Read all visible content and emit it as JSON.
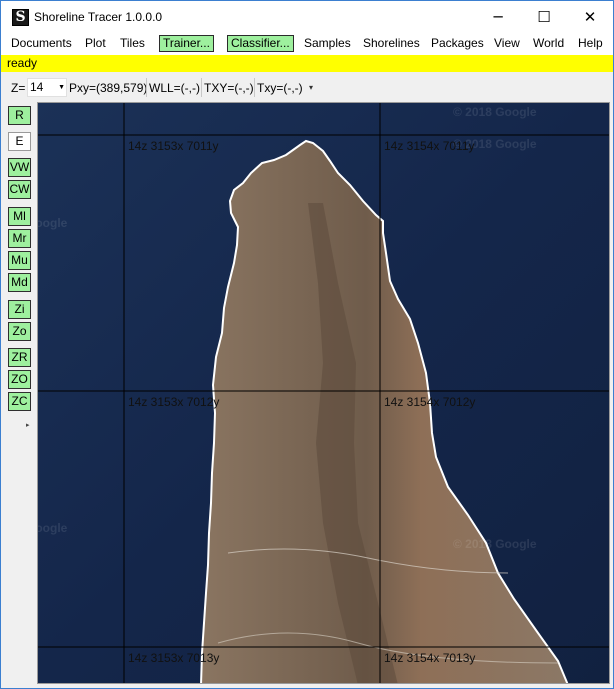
{
  "window": {
    "title": "Shoreline Tracer 1.0.0.0",
    "app_icon_letter": "S",
    "minimize_glyph": "─",
    "maximize_glyph": "☐",
    "close_glyph": "✕"
  },
  "menu": {
    "documents": "Documents",
    "plot": "Plot",
    "tiles": "Tiles",
    "trainer": "Trainer...",
    "classifier": "Classifier...",
    "samples": "Samples",
    "shorelines": "Shorelines",
    "packages": "Packages",
    "view": "View",
    "world": "World",
    "help": "Help"
  },
  "status": {
    "text": "ready"
  },
  "toolbar": {
    "zoom_label": "Z=",
    "zoom_value": "14",
    "pxy": "Pxy=(389,579)",
    "wll": "WLL=(-,-)",
    "txy": "TXY=(-,-)",
    "txy_lower": "Txy=(-,-)"
  },
  "tools": {
    "r": "R",
    "e": "E",
    "vw": "VW",
    "cw": "CW",
    "ml": "Ml",
    "mr": "Mr",
    "mu": "Mu",
    "md": "Md",
    "zi": "Zi",
    "zo": "Zo",
    "zr": "ZR",
    "zo_caps": "ZO",
    "zc": "ZC"
  },
  "map": {
    "tiles": [
      "14z 3153x 7011y",
      "14z 3154x 7011y",
      "14z 3153x 7012y",
      "14z 3154x 7012y",
      "14z 3153x 7013y",
      "14z 3154x 7013y"
    ],
    "watermarks": {
      "copyright_1": "© 2018 Google",
      "copyright_2": "© 2018 Google",
      "google_1": "Google",
      "google_2": "Google",
      "copyright_3": "© 2018 Google"
    },
    "colors": {
      "ocean": "#15294a",
      "land": "#7f6a57",
      "shoreline": "#ffffff",
      "grid": "#000000"
    }
  },
  "colors": {
    "accent_green": "#9ef09e",
    "status_yellow": "#ffff00",
    "window_border": "#3b7fd0"
  }
}
